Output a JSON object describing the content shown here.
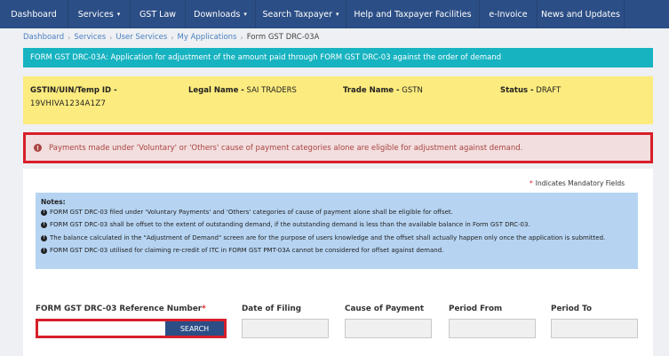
{
  "nav": {
    "items": [
      {
        "label": "Dashboard",
        "dropdown": false
      },
      {
        "label": "Services",
        "dropdown": true
      },
      {
        "label": "GST Law",
        "dropdown": false
      },
      {
        "label": "Downloads",
        "dropdown": true
      },
      {
        "label": "Search Taxpayer",
        "dropdown": true
      },
      {
        "label": "Help and Taxpayer Facilities",
        "dropdown": false
      },
      {
        "label": "e-Invoice",
        "dropdown": false
      },
      {
        "label": "News and Updates",
        "dropdown": false
      }
    ]
  },
  "breadcrumb": {
    "items": [
      "Dashboard",
      "Services",
      "User Services",
      "My Applications"
    ],
    "current": "Form GST DRC-03A"
  },
  "form_header": "FORM GST DRC-03A: Application for adjustment of the amount paid through FORM GST DRC-03 against the order of demand",
  "taxpayer": {
    "gstin_label": "GSTIN/UIN/Temp ID -",
    "gstin_value": "19VHIVA1234A1Z7",
    "legal_label": "Legal Name -",
    "legal_value": "SAI TRADERS",
    "trade_label": "Trade Name -",
    "trade_value": "GSTN",
    "status_label": "Status -",
    "status_value": "DRAFT"
  },
  "alert": {
    "icon": "exclamation-circle-icon",
    "text": "Payments made under 'Voluntary' or 'Others' cause of payment categories alone are eligible for adjustment against demand."
  },
  "mandatory_note": "Indicates Mandatory Fields",
  "notes": {
    "title": "Notes:",
    "items": [
      "FORM GST DRC-03 filed under 'Voluntary Payments' and 'Others' categories of cause of payment alone shall be eligible for offset.",
      "FORM GST DRC-03 shall be offset to the extent of outstanding demand, if the outstanding demand is less than the available balance in Form GST DRC-03.",
      "The balance calculated in the \"Adjustment of Demand\" screen are for the purpose of users knowledge and the offset shall actually happen only once the application is submitted.",
      "FORM GST DRC-03 utilised for claiming re-credit of ITC in FORM GST PMT-03A cannot be considered for offset against demand."
    ]
  },
  "fields": {
    "ref_label": "FORM GST DRC-03 Reference Number",
    "ref_value": "",
    "search_label": "SEARCH",
    "date_label": "Date of Filing",
    "cause_label": "Cause of Payment",
    "from_label": "Period From",
    "to_label": "Period To"
  },
  "colors": {
    "nav": "#2c4e86",
    "header": "#17b3c1",
    "taxpayer_bg": "#fceb7e",
    "alert_border": "#d71f2a",
    "notes_bg": "#b6d4f2"
  }
}
